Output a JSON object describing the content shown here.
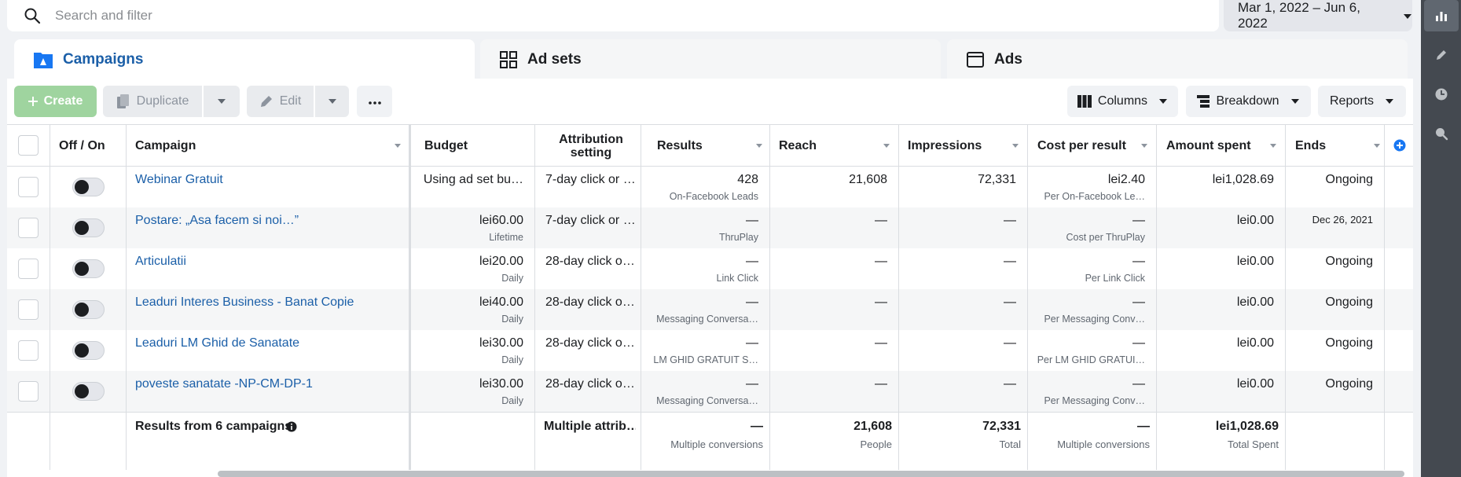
{
  "search": {
    "placeholder": "Search and filter"
  },
  "date_range": "Mar 1, 2022 – Jun 6, 2022",
  "tabs": [
    {
      "label": "Campaigns"
    },
    {
      "label": "Ad sets"
    },
    {
      "label": "Ads"
    }
  ],
  "toolbar": {
    "create": "Create",
    "duplicate": "Duplicate",
    "edit": "Edit",
    "columns": "Columns",
    "breakdown": "Breakdown",
    "reports": "Reports"
  },
  "columns": {
    "off_on": "Off / On",
    "campaign": "Campaign",
    "budget": "Budget",
    "attribution": "Attribution setting",
    "results": "Results",
    "reach": "Reach",
    "impressions": "Impressions",
    "cost_per_result": "Cost per result",
    "amount_spent": "Amount spent",
    "ends": "Ends"
  },
  "rows": [
    {
      "campaign": "Webinar Gratuit",
      "budget": "Using ad set bu…",
      "budget_sub": "",
      "attribution": "7-day click or …",
      "results": "428",
      "results_sub": "On-Facebook Leads",
      "reach": "21,608",
      "impressions": "72,331",
      "cost": "lei2.40",
      "cost_sub": "Per On-Facebook Le…",
      "spent": "lei1,028.69",
      "ends": "Ongoing"
    },
    {
      "campaign": "Postare: „Asa facem si noi…”",
      "budget": "lei60.00",
      "budget_sub": "Lifetime",
      "attribution": "7-day click or …",
      "results": "—",
      "results_sub": "ThruPlay",
      "reach": "—",
      "impressions": "—",
      "cost": "—",
      "cost_sub": "Cost per ThruPlay",
      "spent": "lei0.00",
      "ends": "Dec 26, 2021"
    },
    {
      "campaign": "Articulatii",
      "budget": "lei20.00",
      "budget_sub": "Daily",
      "attribution": "28-day click o…",
      "results": "—",
      "results_sub": "Link Click",
      "reach": "—",
      "impressions": "—",
      "cost": "—",
      "cost_sub": "Per Link Click",
      "spent": "lei0.00",
      "ends": "Ongoing"
    },
    {
      "campaign": "Leaduri Interes Business - Banat Copie",
      "budget": "lei40.00",
      "budget_sub": "Daily",
      "attribution": "28-day click o…",
      "results": "—",
      "results_sub": "Messaging Conversa…",
      "reach": "—",
      "impressions": "—",
      "cost": "—",
      "cost_sub": "Per Messaging Conv…",
      "spent": "lei0.00",
      "ends": "Ongoing"
    },
    {
      "campaign": "Leaduri LM Ghid de Sanatate",
      "budget": "lei30.00",
      "budget_sub": "Daily",
      "attribution": "28-day click o…",
      "results": "—",
      "results_sub": "LM GHID GRATUIT S…",
      "reach": "—",
      "impressions": "—",
      "cost": "—",
      "cost_sub": "Per LM GHID GRATUI…",
      "spent": "lei0.00",
      "ends": "Ongoing"
    },
    {
      "campaign": "poveste sanatate -NP-CM-DP-1",
      "budget": "lei30.00",
      "budget_sub": "Daily",
      "attribution": "28-day click o…",
      "results": "—",
      "results_sub": "Messaging Conversa…",
      "reach": "—",
      "impressions": "—",
      "cost": "—",
      "cost_sub": "Per Messaging Conv…",
      "spent": "lei0.00",
      "ends": "Ongoing"
    }
  ],
  "totals": {
    "label": "Results from 6 campaigns",
    "attribution": "Multiple attrib…",
    "results": "—",
    "results_sub": "Multiple conversions",
    "reach": "21,608",
    "reach_sub": "People",
    "impressions": "72,331",
    "impressions_sub": "Total",
    "cost": "—",
    "cost_sub": "Multiple conversions",
    "spent": "lei1,028.69",
    "spent_sub": "Total Spent"
  },
  "colors": {
    "link": "#1b5fa8",
    "create": "#9fd49f",
    "accent": "#1877f2"
  }
}
